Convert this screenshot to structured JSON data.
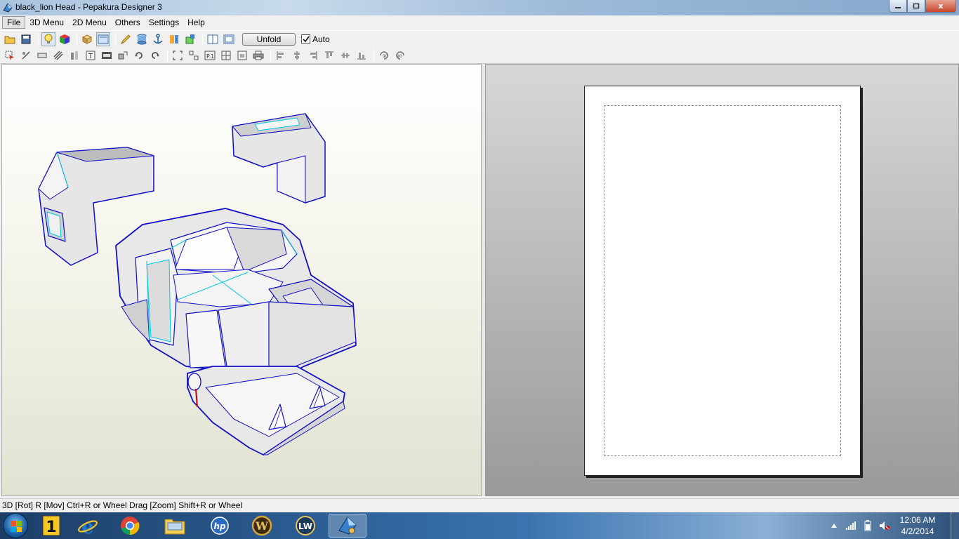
{
  "window": {
    "title": "black_lion Head - Pepakura Designer 3",
    "minimize_icon": "minimize-icon",
    "maximize_icon": "maximize-icon",
    "close_label": "x"
  },
  "menubar": {
    "items": [
      "File",
      "3D Menu",
      "2D Menu",
      "Others",
      "Settings",
      "Help"
    ]
  },
  "toolbar": {
    "unfold_label": "Unfold",
    "auto_label": "Auto",
    "auto_checked": true
  },
  "statusbar": {
    "text": "3D [Rot] R [Mov] Ctrl+R or Wheel Drag [Zoom] Shift+R or Wheel"
  },
  "taskbar": {
    "apps": [
      "start",
      "1password",
      "internet-explorer",
      "chrome",
      "file-explorer",
      "hp",
      "world-of-warcraft",
      "lightwave",
      "pepakura"
    ],
    "lightwave_label": "LW",
    "onepass_label": "1",
    "clock_time": "12:06 AM",
    "clock_date": "4/2/2014"
  },
  "colors": {
    "model_edge": "#1010c8",
    "fold_line": "#00c8e0",
    "cut_line": "#d00000",
    "face": "#e6e6e6"
  }
}
